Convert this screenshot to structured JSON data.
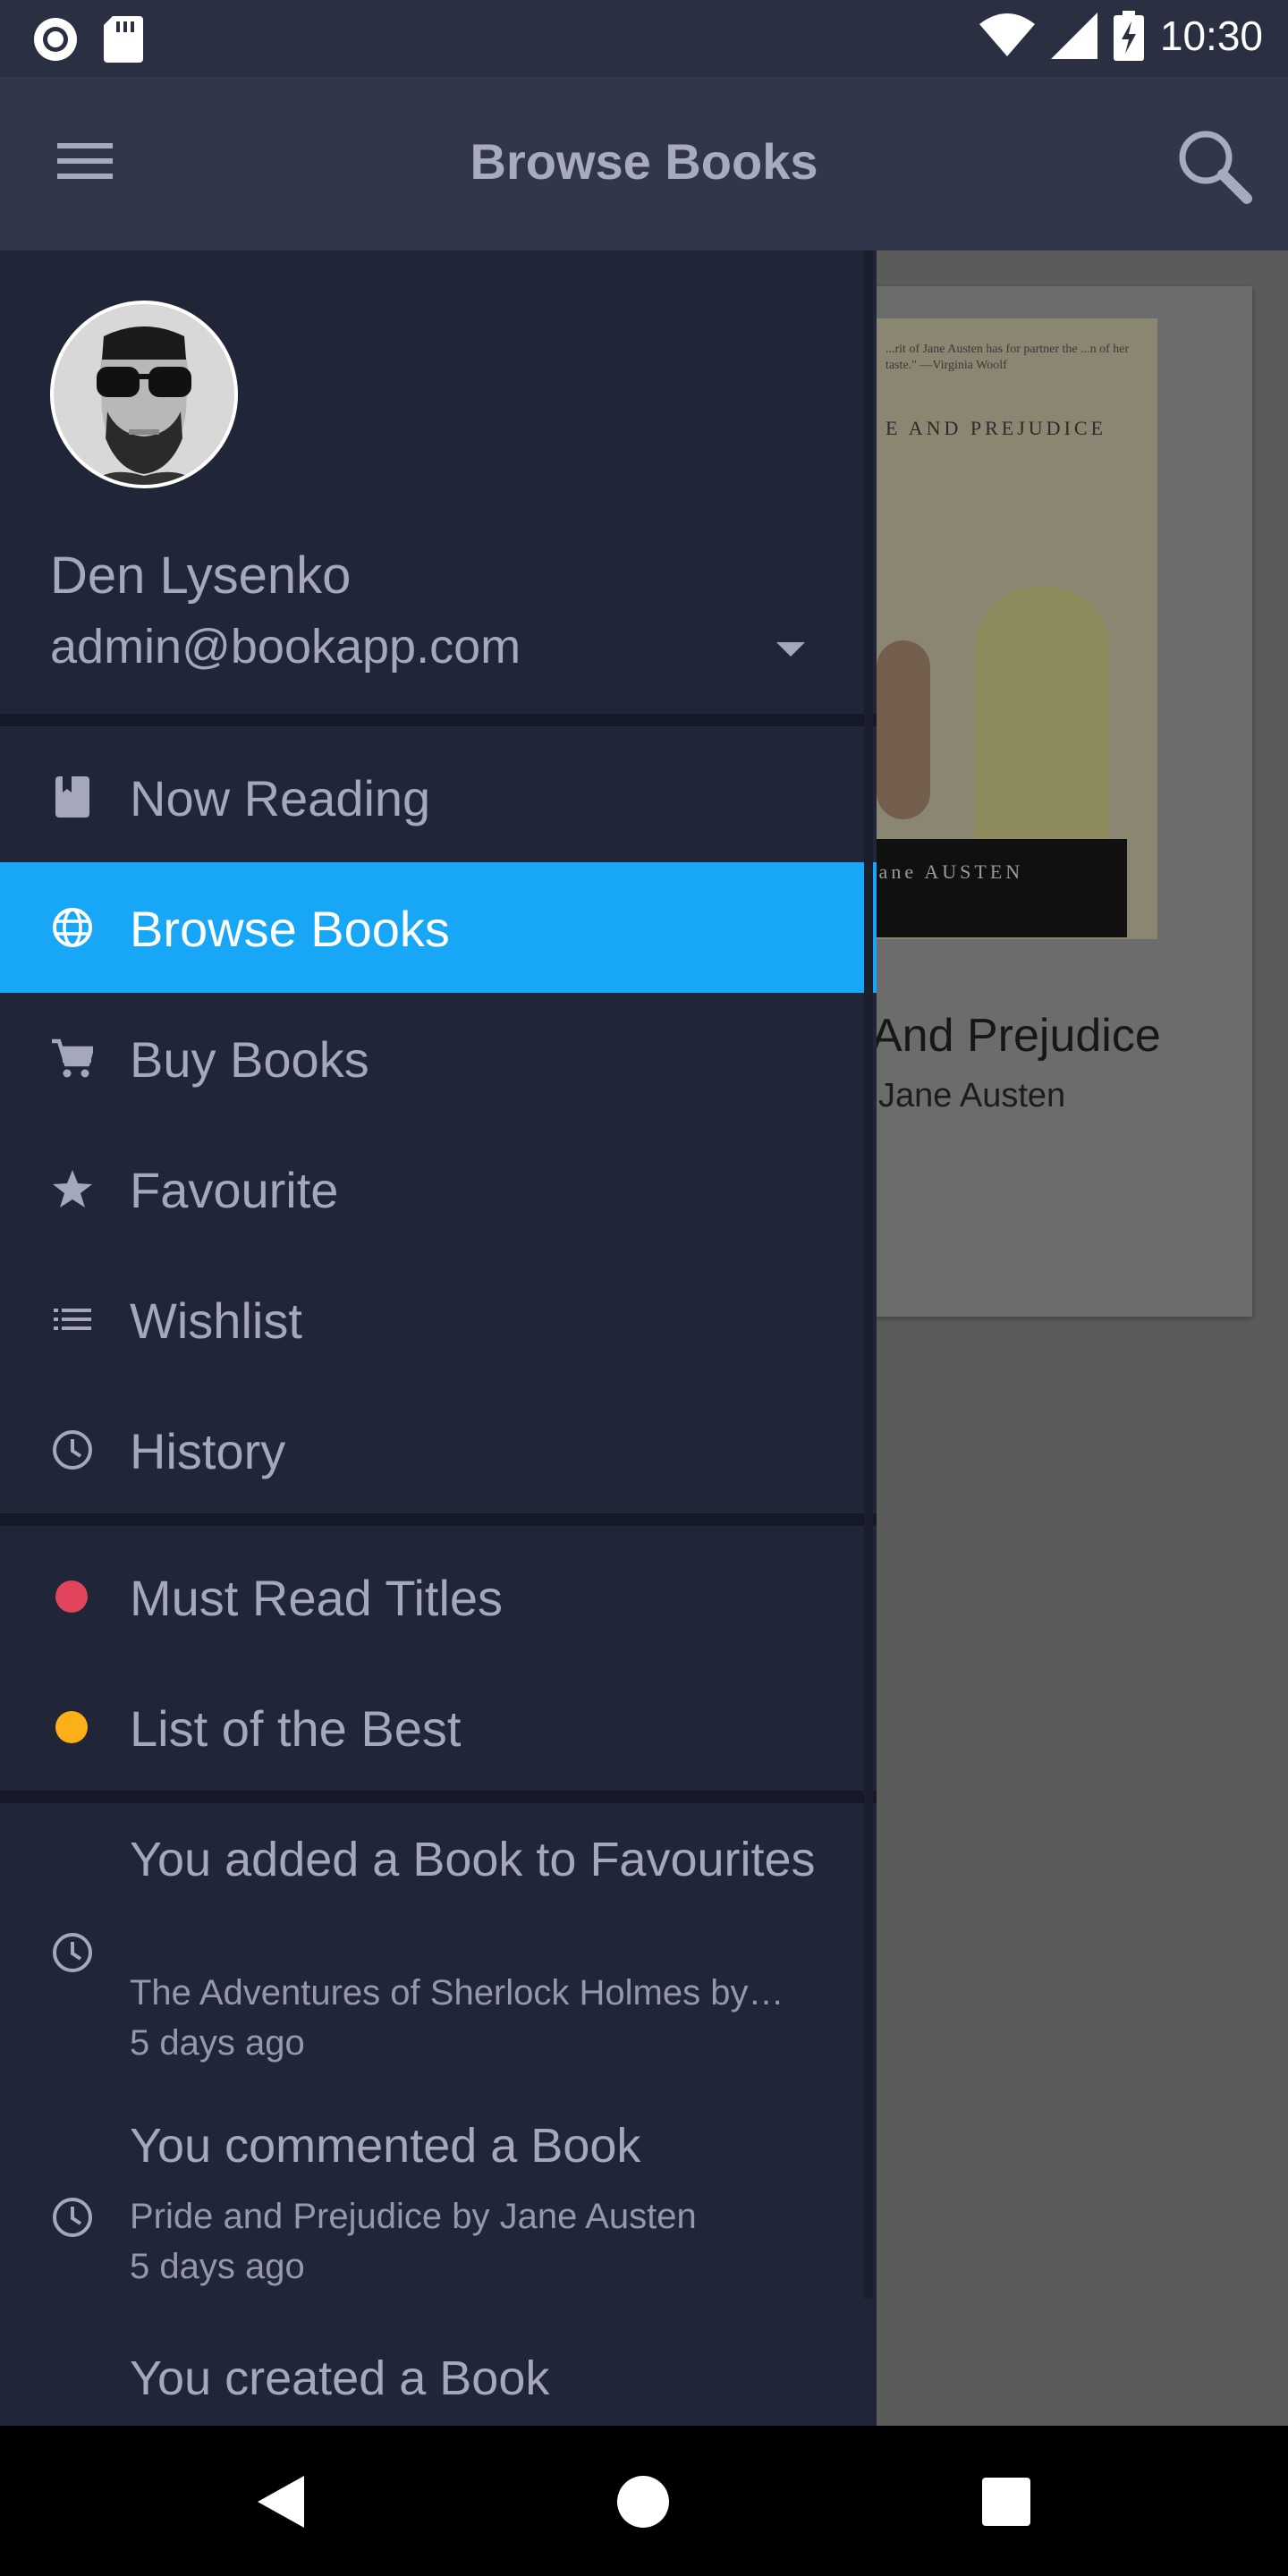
{
  "status_bar": {
    "time": "10:30"
  },
  "app_bar": {
    "title": "Browse Books"
  },
  "background_card": {
    "cover_top_text": "E AND PREJUDICE",
    "cover_blurb": "...rit of Jane Austen has for partner the ...n of her taste.\" —Virginia Woolf",
    "cover_author_band": "Jane AUSTEN",
    "title": "And Prejudice",
    "author": "Jane Austen"
  },
  "drawer": {
    "user": {
      "name": "Den Lysenko",
      "email": "admin@bookapp.com"
    },
    "nav_items": [
      {
        "label": "Now Reading",
        "icon": "book-icon"
      },
      {
        "label": "Browse Books",
        "icon": "globe-icon",
        "active": true
      },
      {
        "label": "Buy Books",
        "icon": "cart-icon"
      },
      {
        "label": "Favourite",
        "icon": "star-icon"
      },
      {
        "label": "Wishlist",
        "icon": "list-icon"
      },
      {
        "label": "History",
        "icon": "clock-icon"
      }
    ],
    "lists": [
      {
        "label": "Must Read Titles",
        "color": "#e2435d"
      },
      {
        "label": "List of the Best",
        "color": "#fbb01a"
      }
    ],
    "activity": [
      {
        "title": "You added a Book to Favourites",
        "subtitle": "The Adventures of Sherlock Holmes by…",
        "time": "5 days ago"
      },
      {
        "title": "You commented a Book",
        "subtitle": "Pride and Prejudice by Jane Austen",
        "time": "5 days ago"
      },
      {
        "title": "You created a Book"
      }
    ]
  },
  "colors": {
    "accent": "#17a7f6",
    "drawer_bg": "#202537",
    "appbar_bg": "#31364b"
  }
}
